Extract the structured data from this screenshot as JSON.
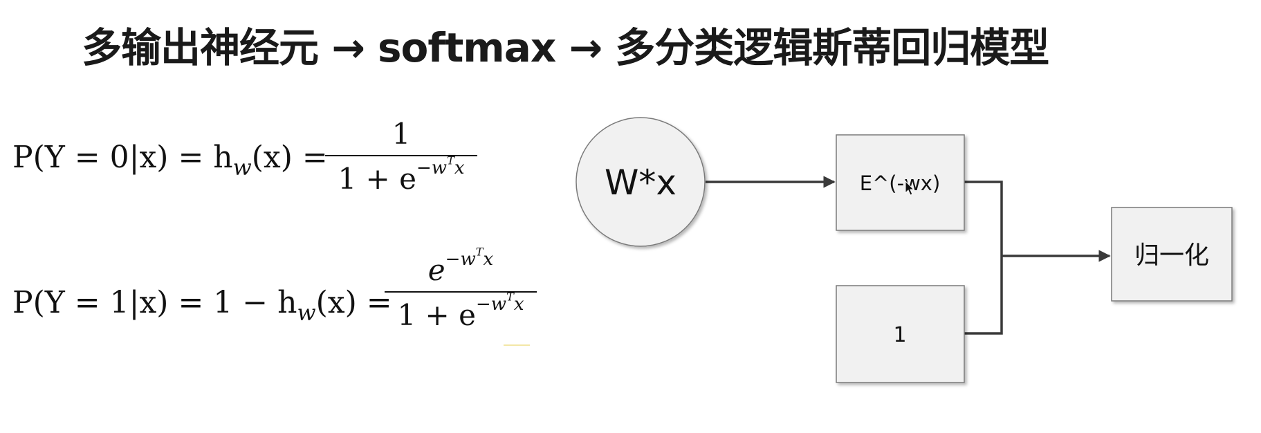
{
  "title": "多输出神经元 → softmax → 多分类逻辑斯蒂回归模型",
  "formula_1": {
    "lhs_prefix": "P(Y = 0|x) = h",
    "lhs_sub": "w",
    "lhs_arg": "(x) =",
    "numerator": "1",
    "den_prefix": "1 + e",
    "den_exp": "−w",
    "den_exp_sup": "T",
    "den_exp_tail": "x"
  },
  "formula_2": {
    "lhs_prefix": "P(Y = 1|x) = 1 − h",
    "lhs_sub": "w",
    "lhs_arg": "(x) =",
    "num_base": "e",
    "num_exp": "−w",
    "num_exp_sup": "T",
    "num_exp_tail": "x",
    "den_prefix": "1 + e",
    "den_exp": "−w",
    "den_exp_sup": "T",
    "den_exp_tail": "x"
  },
  "diagram": {
    "circle_label": "W*x",
    "exp_box_label": "E^(-wx)",
    "one_box_label": "1",
    "normalize_box_label": "归一化",
    "colors": {
      "node_fill": "#f1f1f1",
      "node_border": "#7a7a7a",
      "connector": "#3a3a3a"
    }
  }
}
